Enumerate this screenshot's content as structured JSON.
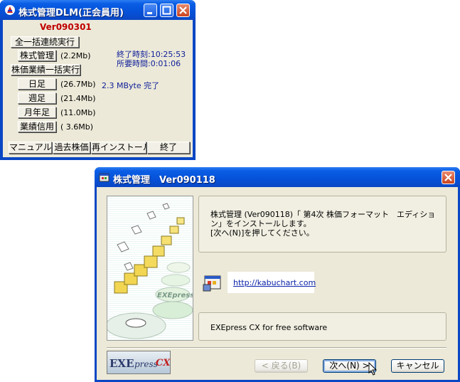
{
  "dlm_window": {
    "title": "株式管理DLM(正会員用)",
    "version": "Ver090301",
    "buttons": {
      "run_all": "全一括連続実行",
      "stock_mgmt": "株式管理",
      "price_perf_all": "株価業績一括実行",
      "daily": "日足",
      "weekly": "週足",
      "monthly": "月年足",
      "perf_credit": "業績信用"
    },
    "sizes": {
      "stock_mgmt": "(2.2Mb)",
      "daily": "(26.7Mb)",
      "weekly": "(21.4Mb)",
      "monthly": "(11.0Mb)",
      "perf_credit": "( 3.6Mb)"
    },
    "end_time": "終了時刻:10:25:53",
    "elapsed": "所要時間:0:01:06",
    "status": "2.3 MByte 完了",
    "bottom_buttons": [
      "マニュアル",
      "過去株価",
      "再インストール",
      "終了"
    ]
  },
  "installer": {
    "title": "株式管理　Ver090118",
    "message_lines": [
      "株式管理 (Ver090118)「 第4次 株価フォーマット　エディショ",
      "ン」をインストールします。",
      "[次へ(N)]を押してください。"
    ],
    "link": "http://kabuchart.com",
    "footer_text": "EXEpress CX for free software",
    "logo": {
      "part1": "EXE",
      "part2": "press",
      "part3": "CX"
    },
    "art_text": "EXEpress",
    "buttons": {
      "back": "< 戻る(B)",
      "next": "次へ(N) >",
      "cancel": "キャンセル"
    }
  }
}
